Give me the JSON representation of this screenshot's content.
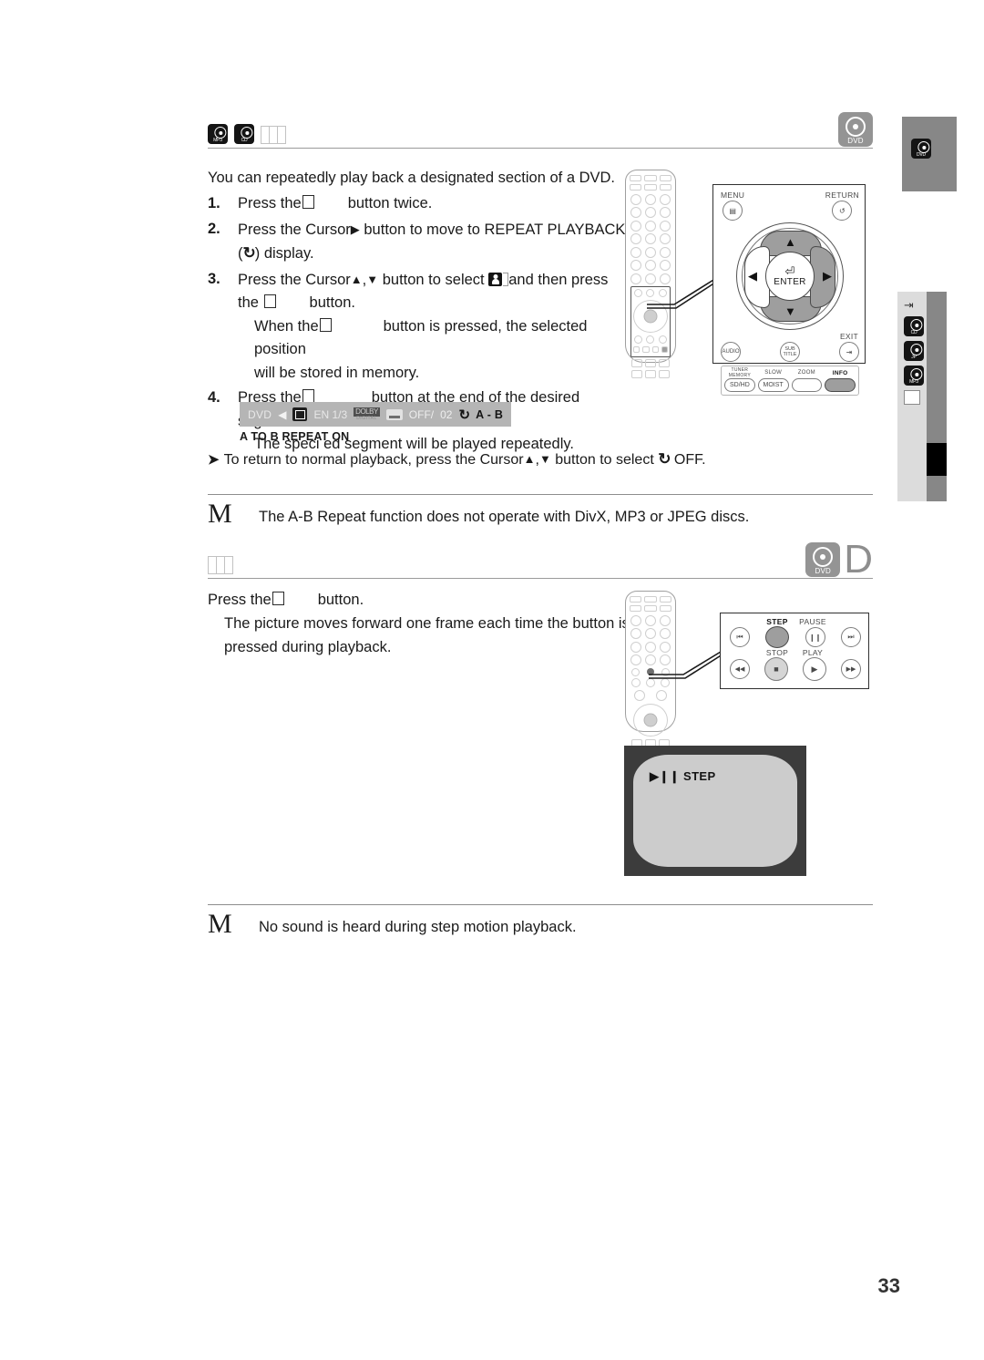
{
  "page": {
    "number": "33"
  },
  "section_ab_repeat": {
    "disc_badges": [
      {
        "name": "mp3-disc-icon",
        "label": "MP3"
      },
      {
        "name": "cd-disc-icon",
        "label": "CD"
      }
    ],
    "placeholder": "",
    "right_badge_label": "DVD",
    "intro": "You can repeatedly play back a designated section of a DVD.",
    "steps": [
      {
        "num": "1.",
        "pre": "Press the",
        "post": "button twice."
      },
      {
        "num": "2.",
        "line1_a": "Press the Cursor",
        "line1_cursor": "▶",
        "line1_b": " button to move to REPEAT PLAYBACK",
        "line2_a": "(",
        "line2_glyph": "↻",
        "line2_b": ") display."
      },
      {
        "num": "3.",
        "line1_a": "Press the Cursor",
        "line1_up": "▲",
        "line1_comma": ",",
        "line1_down": "▼",
        "line1_b": " button to select ",
        "line1_c": "and then press",
        "line2_a": "the",
        "line2_b": "button.",
        "sub1_a": "When the",
        "sub1_b": "button is pressed, the selected position",
        "sub2": "will be stored in memory."
      },
      {
        "num": "4.",
        "line1_a": "Press the",
        "line1_b": "button at the end of the desired segment.",
        "sub1": "The speci ed segment will be played repeatedly."
      }
    ],
    "osd": {
      "source": "DVD",
      "prev_arrow": "◀",
      "angle_icon": "angle-icon",
      "language": "EN 1/3",
      "dolby_top": "DOLBY",
      "dolby_bottom": "DIGITAL",
      "subtitle_icon": "subtitle-icon",
      "subtitle_value": "OFF/",
      "chapter": "02",
      "repeat_glyph": "↻",
      "repeat_mode": "A - B",
      "caption": "A TO B REPEAT ON"
    },
    "bullet": {
      "glyph": "➤",
      "a": "To return to normal playback, press the Cursor",
      "up": "▲",
      "comma": ",",
      "down": "▼",
      "b": " button to select ",
      "repeat_glyph": "↻",
      "c": " OFF."
    },
    "note": {
      "marker": "M",
      "text": "The A-B Repeat function does not operate with DivX, MP3 or JPEG discs."
    },
    "remote_detail": {
      "menu_label": "MENU",
      "return_label": "RETURN",
      "enter_label": "ENTER",
      "audio_label": "AUDIO",
      "subtitle_label_1": "SUB",
      "subtitle_label_2": "TITLE",
      "exit_label": "EXIT",
      "bottom_row": [
        {
          "caption_1": "TUNER",
          "caption_2": "MEMORY",
          "label": "SD/HD",
          "highlight": false
        },
        {
          "caption_1": "SLOW",
          "caption_2": "",
          "label": "MOIST",
          "highlight": false
        },
        {
          "caption_1": "ZOOM",
          "caption_2": "",
          "label": "",
          "highlight": false
        },
        {
          "caption_1": "INFO",
          "caption_2": "",
          "label": "",
          "highlight": true
        }
      ],
      "up_arrow": "▲",
      "down_arrow": "▼",
      "left_arrow": "◀",
      "right_arrow": "▶"
    }
  },
  "section_step_motion": {
    "placeholder": "",
    "right_badge_label": "DVD",
    "right_letter": "D",
    "line1_a": "Press the",
    "line1_b": "button.",
    "line2": "The picture moves forward one frame each time the button is",
    "line3": "pressed during playback.",
    "remote_detail": {
      "step_label": "STEP",
      "pause_label": "PAUSE",
      "stop_label": "STOP",
      "play_label": "PLAY",
      "prev_icon": "⏮",
      "pause_icon": "❙❙",
      "next_icon": "⏭",
      "rew_icon": "◀◀",
      "stop_icon": "■",
      "play_icon": "▶",
      "ff_icon": "▶▶"
    },
    "tv": {
      "indicator": "▶❙❙",
      "text": "STEP"
    },
    "note": {
      "marker": "M",
      "text": "No sound is heard during step motion playback."
    }
  },
  "edge_tabs": {
    "top_badge": "dvd-disc-icon",
    "lower_icons": [
      "hdmi-icon",
      "disc-icon-1",
      "disc-icon-2",
      "disc-icon-3",
      "square-icon"
    ]
  }
}
